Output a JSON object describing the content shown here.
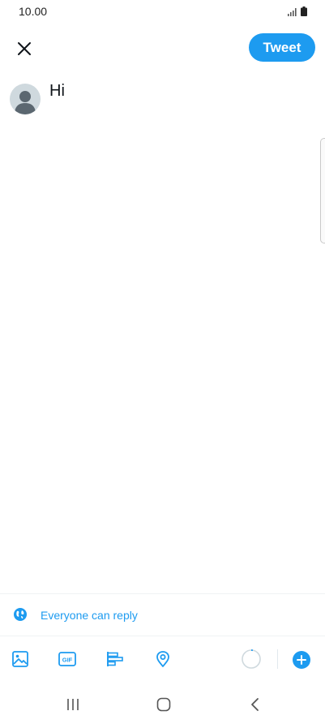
{
  "status_bar": {
    "time": "10.00"
  },
  "header": {
    "tweet_label": "Tweet"
  },
  "compose": {
    "text": "Hi"
  },
  "reply_setting": {
    "label": "Everyone can reply"
  },
  "toolbar": {
    "icons": [
      "image-icon",
      "gif-icon",
      "poll-icon",
      "location-icon"
    ]
  },
  "colors": {
    "accent": "#1d9bf0",
    "text": "#0f1419"
  }
}
